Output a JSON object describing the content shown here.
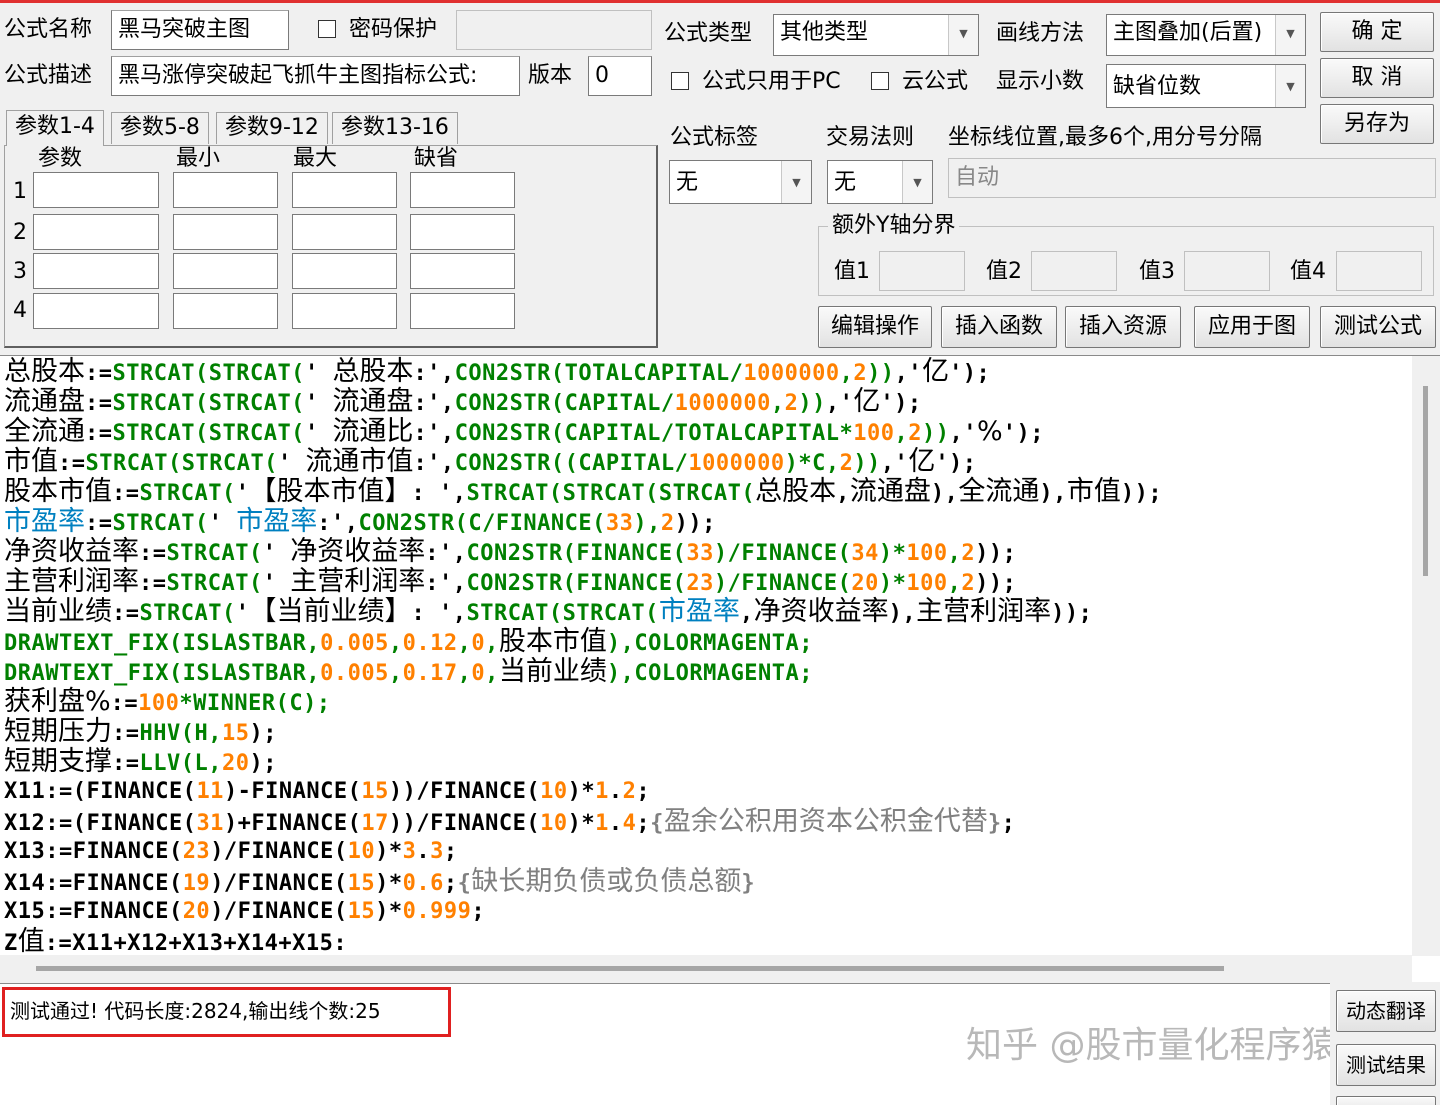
{
  "form": {
    "name_label": "公式名称",
    "name_value": "黑马突破主图",
    "password_label": "密码保护",
    "password_value": "",
    "desc_label": "公式描述",
    "desc_value": "黑马涨停突破起飞抓牛主图指标公式:",
    "version_label": "版本",
    "version_value": "0",
    "type_label": "公式类型",
    "type_value": "其他类型",
    "draw_label": "画线方法",
    "draw_value": "主图叠加(后置)",
    "pc_only_label": "公式只用于PC",
    "cloud_label": "云公式",
    "decimals_label": "显示小数",
    "decimals_value": "缺省位数",
    "tag_label": "公式标签",
    "tag_value": "无",
    "trade_label": "交易法则",
    "trade_value": "无",
    "axis_label": "坐标线位置,最多6个,用分号分隔",
    "axis_value": "自动",
    "extra_y_label": "额外Y轴分界",
    "val1_label": "值1",
    "val2_label": "值2",
    "val3_label": "值3",
    "val4_label": "值4"
  },
  "buttons": {
    "ok": "确  定",
    "cancel": "取  消",
    "save_as": "另存为",
    "edit_ops": "编辑操作",
    "insert_func": "插入函数",
    "insert_res": "插入资源",
    "apply_chart": "应用于图",
    "test_formula": "测试公式",
    "dynamic_translate": "动态翻译",
    "test_result": "测试结果"
  },
  "params": {
    "tabs": [
      "参数1-4",
      "参数5-8",
      "参数9-12",
      "参数13-16"
    ],
    "headers": [
      "参数",
      "最小",
      "最大",
      "缺省"
    ],
    "rows": [
      "1",
      "2",
      "3",
      "4"
    ]
  },
  "colors": {
    "keyword": "#008000",
    "number": "#ff8000",
    "ident": "#000000",
    "link": "#0080c0",
    "comment": "#808080",
    "highlight_box": "#e02020"
  },
  "code_lines": [
    [
      [
        "总股本",
        "i"
      ],
      [
        ":=",
        "i"
      ],
      [
        "STRCAT(STRCAT(",
        "k"
      ],
      [
        "' 总股本:',",
        "i"
      ],
      [
        "CON2STR(TOTALCAPITAL/",
        "k"
      ],
      [
        "1000000",
        "n"
      ],
      [
        ",",
        "k"
      ],
      [
        "2",
        "n"
      ],
      [
        "))",
        "k"
      ],
      [
        ",'亿');",
        "i"
      ]
    ],
    [
      [
        "流通盘",
        "i"
      ],
      [
        ":=",
        "i"
      ],
      [
        "STRCAT(STRCAT(",
        "k"
      ],
      [
        "' 流通盘:',",
        "i"
      ],
      [
        "CON2STR(CAPITAL/",
        "k"
      ],
      [
        "1000000",
        "n"
      ],
      [
        ",",
        "k"
      ],
      [
        "2",
        "n"
      ],
      [
        "))",
        "k"
      ],
      [
        ",'亿');",
        "i"
      ]
    ],
    [
      [
        "全流通",
        "i"
      ],
      [
        ":=",
        "i"
      ],
      [
        "STRCAT(STRCAT(",
        "k"
      ],
      [
        "' 流通比:',",
        "i"
      ],
      [
        "CON2STR(CAPITAL/TOTALCAPITAL*",
        "k"
      ],
      [
        "100",
        "n"
      ],
      [
        ",",
        "k"
      ],
      [
        "2",
        "n"
      ],
      [
        "))",
        "k"
      ],
      [
        ",'%');",
        "i"
      ]
    ],
    [
      [
        "市值",
        "i"
      ],
      [
        ":=",
        "i"
      ],
      [
        "STRCAT(STRCAT(",
        "k"
      ],
      [
        "' 流通市值:',",
        "i"
      ],
      [
        "CON2STR((CAPITAL/",
        "k"
      ],
      [
        "1000000",
        "n"
      ],
      [
        ")*C,",
        "k"
      ],
      [
        "2",
        "n"
      ],
      [
        "))",
        "k"
      ],
      [
        ",'亿');",
        "i"
      ]
    ],
    [
      [
        "股本市值",
        "i"
      ],
      [
        ":=",
        "i"
      ],
      [
        "STRCAT(",
        "k"
      ],
      [
        "'【股本市值】: ',",
        "i"
      ],
      [
        "STRCAT(STRCAT(STRCAT(",
        "k"
      ],
      [
        "总股本,流通盘),全流通),市值));",
        "i"
      ]
    ],
    [
      [
        "市盈率",
        "l"
      ],
      [
        ":=",
        "i"
      ],
      [
        "STRCAT(",
        "k"
      ],
      [
        "' ",
        "i"
      ],
      [
        "市盈率",
        "l"
      ],
      [
        ":',",
        "i"
      ],
      [
        "CON2STR(C/FINANCE(",
        "k"
      ],
      [
        "33",
        "n"
      ],
      [
        "),",
        "k"
      ],
      [
        "2",
        "n"
      ],
      [
        "));",
        "i"
      ]
    ],
    [
      [
        "净资收益率",
        "i"
      ],
      [
        ":=",
        "i"
      ],
      [
        "STRCAT(",
        "k"
      ],
      [
        "' 净资收益率:',",
        "i"
      ],
      [
        "CON2STR(FINANCE(",
        "k"
      ],
      [
        "33",
        "n"
      ],
      [
        ")/FINANCE(",
        "k"
      ],
      [
        "34",
        "n"
      ],
      [
        ")*",
        "k"
      ],
      [
        "100",
        "n"
      ],
      [
        ",",
        "k"
      ],
      [
        "2",
        "n"
      ],
      [
        "));",
        "i"
      ]
    ],
    [
      [
        "主营利润率",
        "i"
      ],
      [
        ":=",
        "i"
      ],
      [
        "STRCAT(",
        "k"
      ],
      [
        "' 主营利润率:',",
        "i"
      ],
      [
        "CON2STR(FINANCE(",
        "k"
      ],
      [
        "23",
        "n"
      ],
      [
        ")/FINANCE(",
        "k"
      ],
      [
        "20",
        "n"
      ],
      [
        ")*",
        "k"
      ],
      [
        "100",
        "n"
      ],
      [
        ",",
        "k"
      ],
      [
        "2",
        "n"
      ],
      [
        "));",
        "i"
      ]
    ],
    [
      [
        "当前业绩",
        "i"
      ],
      [
        ":=",
        "i"
      ],
      [
        "STRCAT(",
        "k"
      ],
      [
        "'【当前业绩】: ',",
        "i"
      ],
      [
        "STRCAT(STRCAT(",
        "k"
      ],
      [
        "市盈率",
        "l"
      ],
      [
        ",净资收益率),主营利润率));",
        "i"
      ]
    ],
    [
      [
        "DRAWTEXT_FIX(ISLASTBAR,",
        "k"
      ],
      [
        "0.005",
        "n"
      ],
      [
        ",",
        "k"
      ],
      [
        "0.12",
        "n"
      ],
      [
        ",",
        "k"
      ],
      [
        "0",
        "n"
      ],
      [
        ",",
        "k"
      ],
      [
        "股本市值",
        "i"
      ],
      [
        "),COLORMAGENTA;",
        "k"
      ]
    ],
    [
      [
        "DRAWTEXT_FIX(ISLASTBAR,",
        "k"
      ],
      [
        "0.005",
        "n"
      ],
      [
        ",",
        "k"
      ],
      [
        "0.17",
        "n"
      ],
      [
        ",",
        "k"
      ],
      [
        "0",
        "n"
      ],
      [
        ",",
        "k"
      ],
      [
        "当前业绩",
        "i"
      ],
      [
        "),COLORMAGENTA;",
        "k"
      ]
    ],
    [
      [
        "获利盘%",
        "i"
      ],
      [
        ":=",
        "i"
      ],
      [
        "100",
        "n"
      ],
      [
        "*WINNER(C);",
        "k"
      ]
    ],
    [
      [
        "短期压力",
        "i"
      ],
      [
        ":=",
        "i"
      ],
      [
        "HHV(H,",
        "k"
      ],
      [
        "15",
        "n"
      ],
      [
        ");",
        "i"
      ]
    ],
    [
      [
        "短期支撑",
        "i"
      ],
      [
        ":=",
        "i"
      ],
      [
        "LLV(L,",
        "k"
      ],
      [
        "20",
        "n"
      ],
      [
        ");",
        "i"
      ]
    ],
    [
      [
        "X11:=(FINANCE(",
        "i"
      ],
      [
        "11",
        "n"
      ],
      [
        ")-FINANCE(",
        "i"
      ],
      [
        "15",
        "n"
      ],
      [
        "))/FINANCE(",
        "i"
      ],
      [
        "10",
        "n"
      ],
      [
        ")*",
        "i"
      ],
      [
        "1",
        "n"
      ],
      [
        ".",
        "i"
      ],
      [
        "2",
        "n"
      ],
      [
        ";",
        "i"
      ]
    ],
    [
      [
        "X12:=(FINANCE(",
        "i"
      ],
      [
        "31",
        "n"
      ],
      [
        ")+FINANCE(",
        "i"
      ],
      [
        "17",
        "n"
      ],
      [
        "))/FINANCE(",
        "i"
      ],
      [
        "10",
        "n"
      ],
      [
        ")*",
        "i"
      ],
      [
        "1",
        "n"
      ],
      [
        ".",
        "i"
      ],
      [
        "4",
        "n"
      ],
      [
        ";",
        "i"
      ],
      [
        "{盈余公积用资本公积金代替}",
        "c"
      ],
      [
        ";",
        "i"
      ]
    ],
    [
      [
        "X13:=FINANCE(",
        "i"
      ],
      [
        "23",
        "n"
      ],
      [
        ")/FINANCE(",
        "i"
      ],
      [
        "10",
        "n"
      ],
      [
        ")*",
        "i"
      ],
      [
        "3",
        "n"
      ],
      [
        ".",
        "i"
      ],
      [
        "3",
        "n"
      ],
      [
        ";",
        "i"
      ]
    ],
    [
      [
        "X14:=FINANCE(",
        "i"
      ],
      [
        "19",
        "n"
      ],
      [
        ")/FINANCE(",
        "i"
      ],
      [
        "15",
        "n"
      ],
      [
        ")*",
        "i"
      ],
      [
        "0.6",
        "n"
      ],
      [
        ";",
        "i"
      ],
      [
        "{缺长期负债或负债总额}",
        "c"
      ]
    ],
    [
      [
        "X15:=FINANCE(",
        "i"
      ],
      [
        "20",
        "n"
      ],
      [
        ")/FINANCE(",
        "i"
      ],
      [
        "15",
        "n"
      ],
      [
        ")*",
        "i"
      ],
      [
        "0.999",
        "n"
      ],
      [
        ";",
        "i"
      ]
    ],
    [
      [
        "Z值:=X11+X12+X13+X14+X15:",
        "i"
      ]
    ]
  ],
  "status": {
    "message": "测试通过! 代码长度:2824,输出线个数:25"
  },
  "watermark": "知乎 @股市量化程序猿"
}
